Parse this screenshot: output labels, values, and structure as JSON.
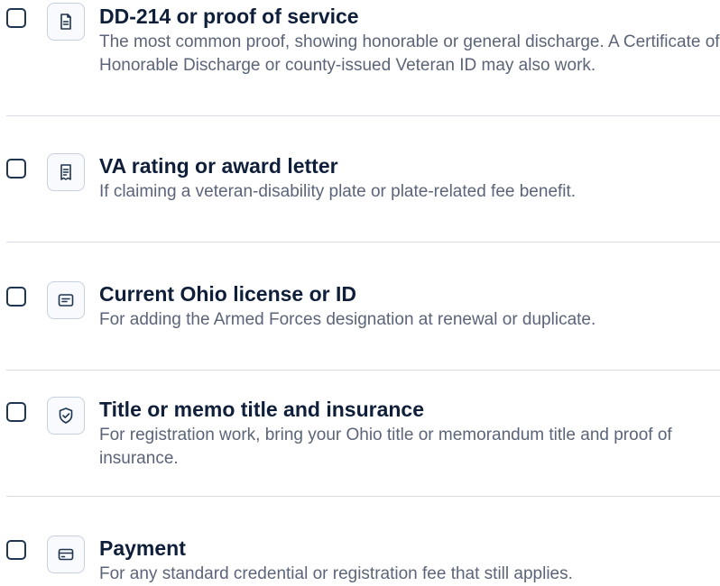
{
  "checklist": {
    "items": [
      {
        "icon": "document-icon",
        "title": "DD-214 or proof of service",
        "description": "The most common proof, showing honorable or general discharge. A Certificate of Honorable Discharge or county-issued Veteran ID may also work."
      },
      {
        "icon": "receipt-icon",
        "title": "VA rating or award letter",
        "description": "If claiming a veteran-disability plate or plate-related fee benefit."
      },
      {
        "icon": "id-card-icon",
        "title": "Current Ohio license or ID",
        "description": "For adding the Armed Forces designation at renewal or duplicate."
      },
      {
        "icon": "shield-check-icon",
        "title": "Title or memo title and insurance",
        "description": "For registration work, bring your Ohio title or memorandum title and proof of insurance."
      },
      {
        "icon": "credit-card-icon",
        "title": "Payment",
        "description": "For any standard credential or registration fee that still applies."
      }
    ]
  }
}
